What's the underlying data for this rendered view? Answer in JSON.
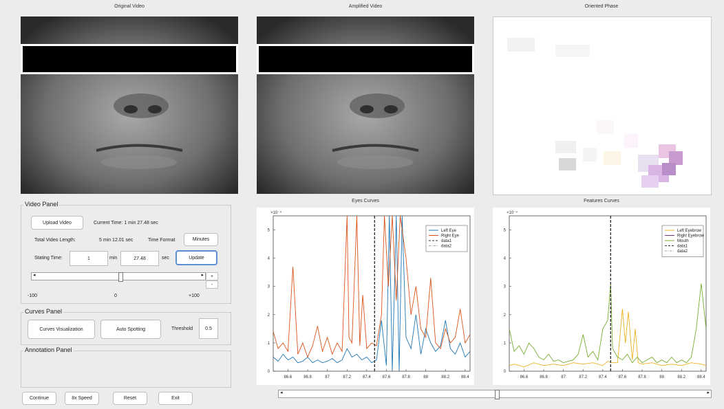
{
  "titles": {
    "original": "Original Video",
    "amplified": "Amplified Video",
    "phase": "Oriented Phase",
    "eyes": "Eyes Curves",
    "features": "Features Curves"
  },
  "video_panel": {
    "title": "Video Panel",
    "upload_label": "Upload Video",
    "current_time": "Current Time: 1 min 27.48 sec",
    "total_length_label": "Total Video Length:",
    "total_length_value": "5 min 12.01 sec",
    "time_format_label": "Time Format",
    "minutes_label": "Minutes",
    "starting_time_label": "Stating Time:",
    "start_min_value": "1",
    "min_unit": "min",
    "start_sec_value": "27.48",
    "sec_unit": "sec",
    "update_label": "Update",
    "plus_label": "+",
    "minus_label": "-",
    "slider_min": "-100",
    "slider_mid": "0",
    "slider_max": "+100",
    "slider_value": 0
  },
  "curves_panel": {
    "title": "Curves Panel",
    "visualization_label": "Curves Visualization",
    "auto_spotting_label": "Auto Spotting",
    "threshold_label": "Threshold",
    "threshold_value": "0.5"
  },
  "annotation_panel": {
    "title": "Annotation Panel"
  },
  "bottom_buttons": {
    "continue": "Continue",
    "speed": "8x Speed",
    "reset": "Reset",
    "exit": "Exit"
  },
  "timeline": {
    "value": 0.5
  },
  "chart_data": [
    {
      "type": "line",
      "title": "Eyes Curves",
      "exponent_label": "×10⁻⁴",
      "xlim": [
        86.45,
        88.45
      ],
      "ylim": [
        0,
        5.5
      ],
      "x_ticks": [
        "86.6",
        "86.8",
        "87",
        "87.2",
        "87.4",
        "87.6",
        "87.8",
        "88",
        "88.2",
        "88.4"
      ],
      "y_ticks": [
        "0",
        "1",
        "2",
        "3",
        "4",
        "5"
      ],
      "series": [
        {
          "name": "Left Eye",
          "color": "#1f77b4",
          "style": "solid",
          "x": [
            86.45,
            86.5,
            86.55,
            86.6,
            86.65,
            86.7,
            86.75,
            86.8,
            86.85,
            86.9,
            86.95,
            87.0,
            87.05,
            87.1,
            87.15,
            87.2,
            87.25,
            87.3,
            87.35,
            87.4,
            87.45,
            87.5,
            87.55,
            87.6,
            87.63,
            87.66,
            87.7,
            87.73,
            87.76,
            87.8,
            87.85,
            87.9,
            87.95,
            88.0,
            88.05,
            88.1,
            88.15,
            88.2,
            88.25,
            88.3,
            88.35,
            88.4,
            88.45
          ],
          "y": [
            0.5,
            0.35,
            0.6,
            0.4,
            0.5,
            0.3,
            0.35,
            0.5,
            0.3,
            0.4,
            0.3,
            0.35,
            0.45,
            0.3,
            0.4,
            0.8,
            0.5,
            0.6,
            0.4,
            0.5,
            0.3,
            0.4,
            1.8,
            0.2,
            5.5,
            0,
            5.5,
            0,
            5.5,
            1.2,
            0.8,
            2.0,
            0.6,
            1.5,
            1.0,
            0.7,
            0.9,
            1.8,
            0.8,
            0.6,
            1.0,
            0.5,
            0.7
          ]
        },
        {
          "name": "Right Eye",
          "color": "#d95319",
          "style": "solid",
          "x": [
            86.45,
            86.5,
            86.55,
            86.6,
            86.65,
            86.7,
            86.75,
            86.8,
            86.85,
            86.9,
            86.95,
            87.0,
            87.05,
            87.1,
            87.15,
            87.2,
            87.22,
            87.25,
            87.3,
            87.33,
            87.36,
            87.4,
            87.45,
            87.5,
            87.55,
            87.58,
            87.62,
            87.66,
            87.7,
            87.74,
            87.8,
            87.85,
            87.9,
            87.95,
            88.0,
            88.05,
            88.1,
            88.15,
            88.2,
            88.25,
            88.3,
            88.35,
            88.4,
            88.45
          ],
          "y": [
            1.4,
            0.8,
            1.0,
            0.7,
            3.7,
            0.6,
            1.0,
            0.5,
            0.9,
            1.6,
            0.7,
            1.2,
            0.6,
            1.0,
            0.7,
            5.5,
            1.2,
            1.0,
            5.5,
            0.9,
            2.7,
            0.8,
            1.0,
            0.9,
            2.0,
            5.5,
            3.0,
            5.5,
            2.5,
            5.5,
            4.0,
            2.0,
            3.0,
            1.5,
            1.2,
            3.3,
            1.0,
            0.8,
            1.5,
            1.0,
            1.2,
            2.2,
            1.0,
            1.3
          ]
        },
        {
          "name": "data1",
          "color": "#333333",
          "style": "dashed",
          "x": [
            87.48,
            87.48
          ],
          "y": [
            0,
            5.5
          ]
        },
        {
          "name": "data2",
          "color": "#999999",
          "style": "dashdot",
          "x": [],
          "y": []
        }
      ]
    },
    {
      "type": "line",
      "title": "Features Curves",
      "exponent_label": "×10⁻⁴",
      "xlim": [
        86.45,
        88.45
      ],
      "ylim": [
        0,
        5.5
      ],
      "x_ticks": [
        "86.6",
        "86.8",
        "87",
        "87.2",
        "87.4",
        "87.6",
        "87.8",
        "88",
        "88.2",
        "88.4"
      ],
      "y_ticks": [
        "0",
        "1",
        "2",
        "3",
        "4",
        "5"
      ],
      "series": [
        {
          "name": "Left Eyebrow",
          "color": "#edb120",
          "style": "solid",
          "x": [
            86.45,
            86.5,
            86.6,
            86.7,
            86.8,
            86.9,
            87.0,
            87.1,
            87.2,
            87.3,
            87.4,
            87.45,
            87.5,
            87.55,
            87.6,
            87.63,
            87.66,
            87.7,
            87.73,
            87.76,
            87.8,
            87.9,
            88.0,
            88.1,
            88.2,
            88.3,
            88.4,
            88.45
          ],
          "y": [
            0.2,
            0.25,
            0.15,
            0.3,
            0.2,
            0.25,
            0.2,
            0.3,
            0.25,
            0.3,
            0.2,
            0.35,
            0.3,
            0.3,
            2.2,
            1.0,
            2.1,
            0.4,
            1.5,
            0.3,
            0.25,
            0.3,
            0.2,
            0.25,
            0.2,
            0.3,
            0.25,
            0.2
          ]
        },
        {
          "name": "Right Eyebrow",
          "color": "#7e2f8e",
          "style": "solid",
          "x": [],
          "y": []
        },
        {
          "name": "Mouth",
          "color": "#77ac30",
          "style": "solid",
          "x": [
            86.45,
            86.5,
            86.55,
            86.6,
            86.65,
            86.7,
            86.75,
            86.8,
            86.85,
            86.9,
            86.95,
            87.0,
            87.05,
            87.1,
            87.15,
            87.2,
            87.25,
            87.3,
            87.35,
            87.4,
            87.45,
            87.48,
            87.5,
            87.55,
            87.6,
            87.65,
            87.7,
            87.75,
            87.8,
            87.85,
            87.9,
            87.95,
            88.0,
            88.05,
            88.1,
            88.15,
            88.2,
            88.25,
            88.3,
            88.35,
            88.4,
            88.45
          ],
          "y": [
            1.5,
            0.7,
            0.9,
            0.6,
            1.0,
            0.8,
            0.5,
            0.4,
            0.6,
            0.35,
            0.4,
            0.3,
            0.35,
            0.4,
            0.6,
            1.3,
            0.5,
            0.7,
            0.4,
            1.5,
            1.8,
            3.1,
            0.8,
            0.5,
            0.4,
            0.6,
            0.3,
            0.5,
            0.3,
            0.4,
            0.5,
            0.3,
            0.4,
            0.3,
            0.5,
            0.3,
            0.4,
            0.3,
            0.5,
            1.5,
            3.1,
            1.5
          ]
        },
        {
          "name": "data1",
          "color": "#333333",
          "style": "dashed",
          "x": [
            87.48,
            87.48
          ],
          "y": [
            0,
            5.5
          ]
        },
        {
          "name": "data2",
          "color": "#999999",
          "style": "dashdot",
          "x": [],
          "y": []
        }
      ]
    }
  ]
}
